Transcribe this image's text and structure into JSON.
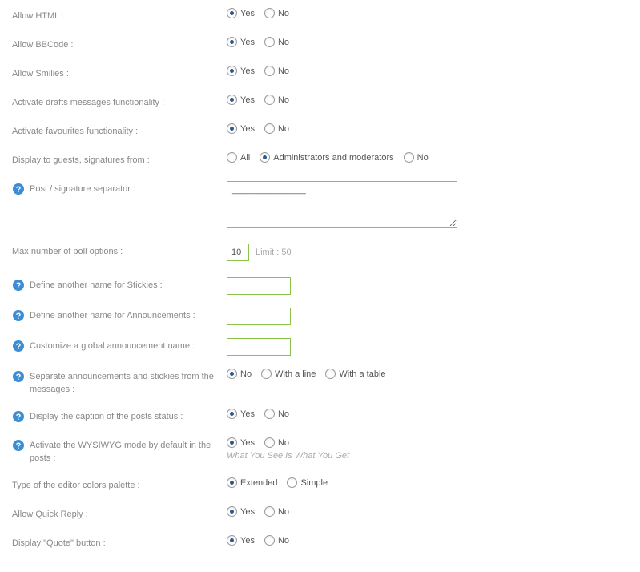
{
  "options": {
    "yes": "Yes",
    "no": "No",
    "all": "All",
    "admins_mods": "Administrators and moderators",
    "with_line": "With a line",
    "with_table": "With a table",
    "extended": "Extended",
    "simple": "Simple"
  },
  "rows": {
    "allow_html": {
      "label": "Allow HTML :",
      "selected": "yes"
    },
    "allow_bbcode": {
      "label": "Allow BBCode :",
      "selected": "yes"
    },
    "allow_smilies": {
      "label": "Allow Smilies :",
      "selected": "yes"
    },
    "activate_drafts": {
      "label": "Activate drafts messages functionality :",
      "selected": "yes"
    },
    "activate_favourites": {
      "label": "Activate favourites functionality :",
      "selected": "yes"
    },
    "display_guests_sigs": {
      "label": "Display to guests, signatures from :",
      "selected": "admins_mods"
    },
    "post_sig_separator": {
      "label": "Post / signature separator :",
      "value": "_______________"
    },
    "max_poll_options": {
      "label": "Max number of poll options :",
      "value": "10",
      "limit": "Limit : 50"
    },
    "define_stickies": {
      "label": "Define another name for Stickies :",
      "value": ""
    },
    "define_announcements": {
      "label": "Define another name for Announcements :",
      "value": ""
    },
    "customize_global": {
      "label": "Customize a global announcement name :",
      "value": ""
    },
    "separate_ann_stickies": {
      "label": "Separate announcements and stickies from the messages :",
      "selected": "no"
    },
    "display_caption": {
      "label": "Display the caption of the posts status :",
      "selected": "yes"
    },
    "activate_wysiwyg": {
      "label": "Activate the WYSIWYG mode by default in the posts :",
      "selected": "yes",
      "hint": "What You See Is What You Get"
    },
    "editor_colors": {
      "label": "Type of the editor colors palette :",
      "selected": "extended"
    },
    "allow_quick_reply": {
      "label": "Allow Quick Reply :",
      "selected": "yes"
    },
    "display_quote": {
      "label": "Display \"Quote\" button :",
      "selected": "yes"
    }
  }
}
